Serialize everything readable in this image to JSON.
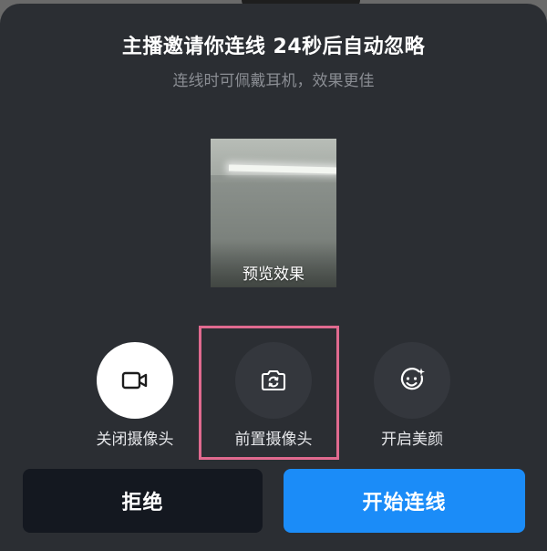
{
  "dialog": {
    "title": "主播邀请你连线 24秒后自动忽略",
    "subtitle": "连线时可佩戴耳机，效果更佳"
  },
  "preview": {
    "label": "预览效果"
  },
  "controls": [
    {
      "label": "关闭摄像头",
      "icon": "video-camera-icon",
      "active": true
    },
    {
      "label": "前置摄像头",
      "icon": "camera-switch-icon",
      "active": false
    },
    {
      "label": "开启美颜",
      "icon": "beauty-face-icon",
      "active": false
    }
  ],
  "buttons": {
    "reject_label": "拒绝",
    "accept_label": "开始连线"
  },
  "colors": {
    "sheet_background": "#2b2e33",
    "accept_button": "#1b8cf8",
    "reject_button": "#141820",
    "highlight_border": "#e06a8f"
  }
}
